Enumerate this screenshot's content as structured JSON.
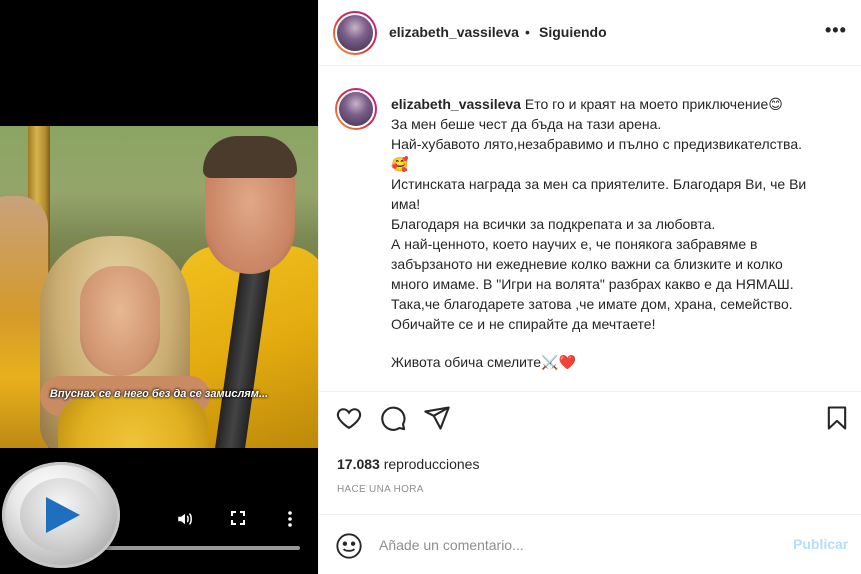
{
  "video": {
    "subtitle": "Впуснах се в него без да се замислям..."
  },
  "header": {
    "username": "elizabeth_vassileva",
    "separator": "•",
    "follow_status": "Siguiendo",
    "more_label": "•••"
  },
  "caption": {
    "username": "elizabeth_vassileva",
    "lines": [
      "Ето го и краят на моето приключение😊",
      "За мен беше чест да бъда на тази арена.",
      "Най-хубавото лято,незабравимо и пълно с предизвикателства.",
      "🥰",
      "Истинската награда за мен са приятелите. Благодаря Ви, че Ви",
      "има!",
      "Благодаря на всички за подкрепата и за любовта.",
      "А най-ценното, което научих е, че понякога забравяме в",
      "забързаното ни ежедневие колко важни са близките и колко",
      "много имаме. В \"Игри на волята\" разбрах какво е да НЯМАШ.",
      "Така,че благодарете затова ,че имате дом, храна, семейство.",
      "Обичайте се и не спирайте да мечтаете!"
    ],
    "last_line": "Живота обича смелите⚔️❤️"
  },
  "stats": {
    "views_count": "17.083",
    "views_label": "reproducciones",
    "time": "HACE UNA HORA"
  },
  "comment": {
    "placeholder": "Añade un comentario...",
    "publish_label": "Publicar",
    "publish_color": "#b2dffc"
  },
  "icons": {
    "like": "heart-icon",
    "comment": "speech-bubble-icon",
    "share": "paper-plane-icon",
    "save": "bookmark-icon",
    "emoji": "smiley-icon",
    "volume": "speaker-icon",
    "fullscreen": "fullscreen-icon",
    "more": "vertical-dots-icon",
    "play": "play-icon"
  }
}
